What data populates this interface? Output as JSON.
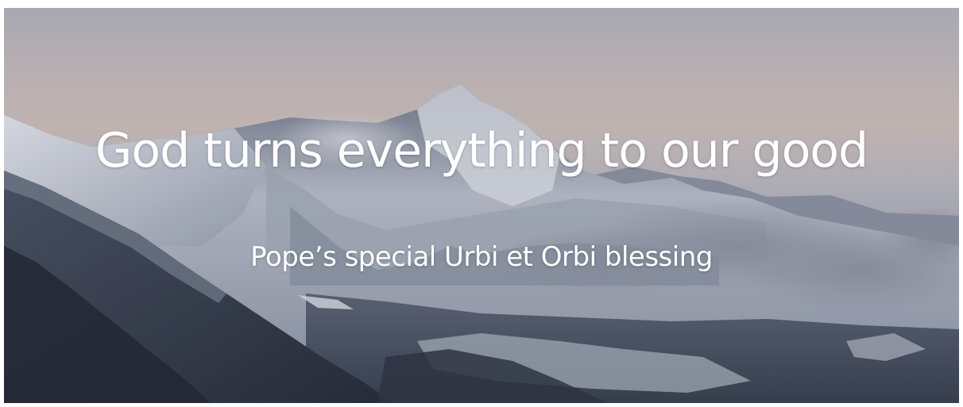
{
  "hero": {
    "title": "God turns everything to our good",
    "subtitle": "Pope’s special Urbi et Orbi blessing",
    "background": "snowy-mountain-landscape-photo"
  }
}
